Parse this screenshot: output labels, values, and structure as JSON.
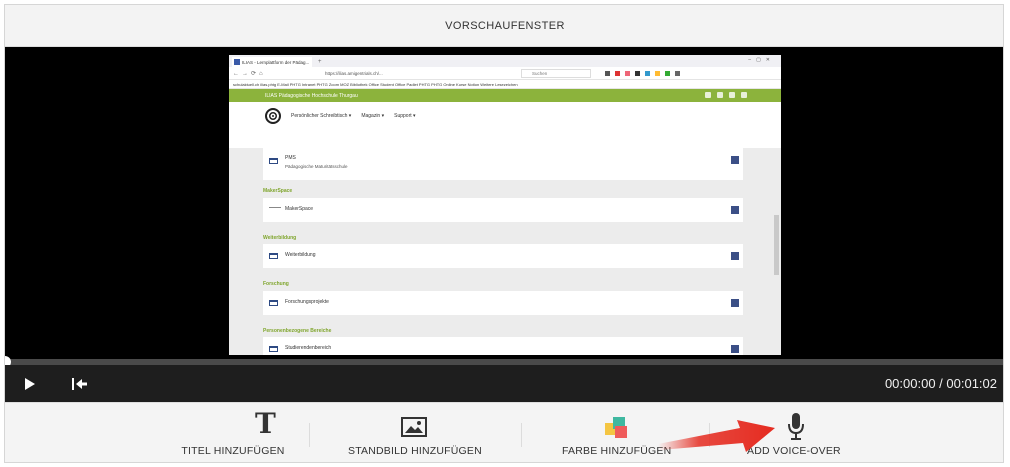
{
  "header": {
    "title": "VORSCHAUFENSTER"
  },
  "preview": {
    "browser": {
      "tab_title": "ILIAS - Lernplattform der Pädag...",
      "url": "https://ilias.amigentrials.ch/...",
      "search_placeholder": "Suchen",
      "bookmarks": "schulaktuell.ch   ilias.phtg   E-Mail PHTG   Intranet PHTG   Zoom   MOZ Bibliothek   Office   Student Office   Padlet   PHTG   PHTG Online Kurse   Notion   Weitere Lesezeichen"
    },
    "ilias": {
      "brand": "ILIAS Pädagogische Hochschule Thurgau",
      "menu": [
        "Persönlicher Schreibtisch ▾",
        "Magazin ▾",
        "Support ▾"
      ],
      "items": [
        {
          "title": "PMS",
          "subtitle": "Pädagogische Maturitätsschule"
        },
        {
          "section": "MakerSpace",
          "title": "MakerSpace"
        },
        {
          "section": "Weiterbildung",
          "title": "Weiterbildung"
        },
        {
          "section": "Forschung",
          "title": "Forschungsprojekte"
        },
        {
          "section": "Personenbezogene Bereiche",
          "title": "Studierendenbereich"
        }
      ]
    }
  },
  "player": {
    "time": "00:00:00 / 00:01:02",
    "progress": 0
  },
  "toolbar": {
    "title_label": "TITEL HINZUFÜGEN",
    "still_label": "STANDBILD HINZUFÜGEN",
    "color_label": "FARBE HINZUFÜGEN",
    "voice_label": "ADD VOICE-OVER"
  },
  "colors": {
    "accent_green": "#8cb33c",
    "arrow_red": "#e52b20"
  }
}
